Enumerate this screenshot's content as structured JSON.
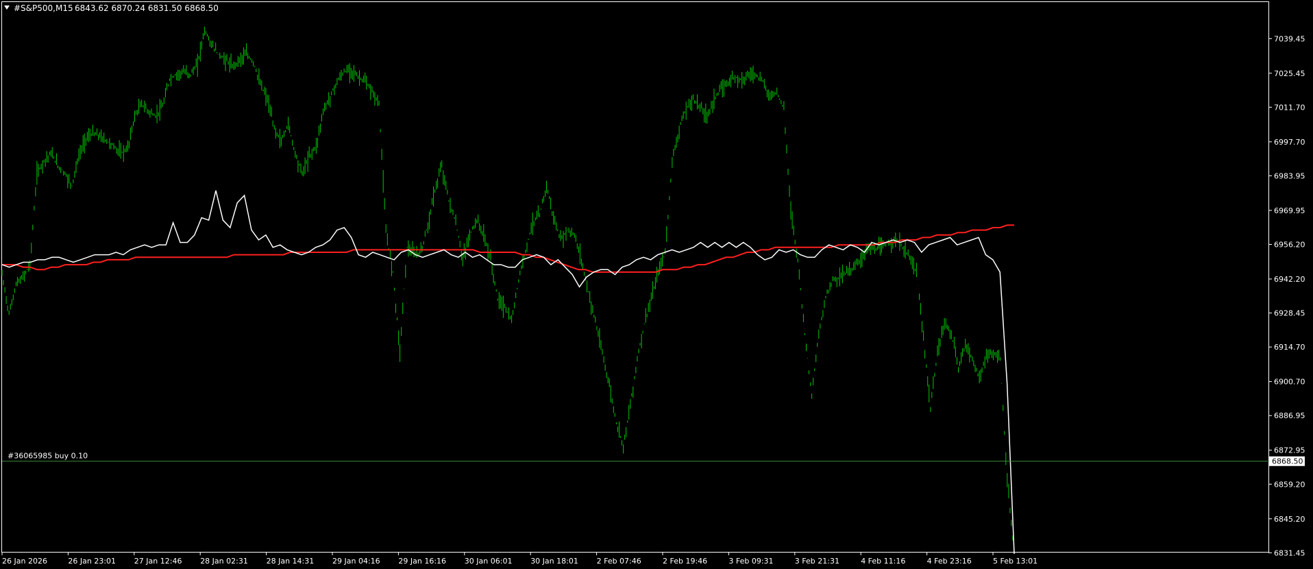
{
  "header": {
    "symbol": "#S&P500,M15",
    "ohlc": "6843.62 6870.24 6831.50 6868.50"
  },
  "order_label": "#36065985 buy 0.10",
  "current_price_label": "6868.50",
  "colors": {
    "background": "#000000",
    "axis": "#ffffff",
    "candles": "#00c800",
    "moving_average": "#ff1f1f",
    "indicator": "#ffffff",
    "order_line": "#3f8f3f",
    "price_box_bg": "#ffffff",
    "price_box_text": "#000000"
  },
  "icons": {
    "menu": "triangle-down-icon"
  },
  "chart_data": {
    "type": "line",
    "y_ticks": [
      "7039.45",
      "7025.45",
      "7011.70",
      "6997.70",
      "6983.95",
      "6969.95",
      "6956.20",
      "6942.20",
      "6928.45",
      "6914.70",
      "6900.70",
      "6886.95",
      "6872.95",
      "6859.20",
      "6845.20",
      "6831.45"
    ],
    "x_ticks": [
      "26 Jan 2026",
      "26 Jan 23:01",
      "27 Jan 12:46",
      "28 Jan 02:31",
      "28 Jan 14:31",
      "29 Jan 04:16",
      "29 Jan 16:16",
      "30 Jan 06:01",
      "30 Jan 18:01",
      "2 Feb 07:46",
      "2 Feb 19:46",
      "3 Feb 09:31",
      "3 Feb 21:31",
      "4 Feb 11:16",
      "4 Feb 23:16",
      "5 Feb 13:01"
    ],
    "ylim": [
      6826.0,
      7053.4
    ],
    "series": [
      {
        "values": [
          6944,
          6928,
          6940,
          6943,
          6948,
          6985,
          6990,
          6993,
          6988,
          6985,
          6980,
          6992,
          6999,
          7001,
          7000,
          6998,
          6996,
          6993,
          6995,
          7008,
          7013,
          7010,
          7008,
          7012,
          7023,
          7025,
          7026,
          7025,
          7029,
          7043,
          7037,
          7033,
          7031,
          7028,
          7031,
          7033,
          7030,
          7021,
          7015,
          7003,
          6998,
          7005,
          6993,
          6985,
          6992,
          6996,
          7010,
          7016,
          7022,
          7026,
          7027,
          7024,
          7022,
          7018,
          7013,
          6961,
          6945,
          6913,
          6955,
          6952,
          6953,
          6964,
          6978,
          6988,
          6974,
          6965,
          6950,
          6960,
          6966,
          6960,
          6950,
          6934,
          6931,
          6925,
          6942,
          6954,
          6965,
          6968,
          6980,
          6967,
          6958,
          6962,
          6960,
          6950,
          6937,
          6925,
          6912,
          6899,
          6884,
          6875,
          6891,
          6910,
          6924,
          6934,
          6945,
          6953,
          6990,
          7003,
          7011,
          7015,
          7012,
          7008,
          7015,
          7019,
          7022,
          7024,
          7023,
          7025,
          7025,
          7022,
          7016,
          7018,
          7011,
          6970,
          6950,
          6920,
          6895,
          6920,
          6935,
          6942,
          6943,
          6945,
          6947,
          6950,
          6955,
          6954,
          6955,
          6957,
          6958,
          6955,
          6951,
          6945,
          6918,
          6890,
          6912,
          6925,
          6920,
          6906,
          6916,
          6910,
          6902,
          6911,
          6912,
          6910,
          6860,
          6831
        ]
      },
      {
        "values": [
          6948,
          6947,
          6948,
          6949,
          6949,
          6950,
          6950,
          6951,
          6951,
          6950,
          6949,
          6950,
          6951,
          6952,
          6952,
          6952,
          6953,
          6952,
          6954,
          6955,
          6956,
          6955,
          6956,
          6956,
          6965,
          6957,
          6957,
          6960,
          6967,
          6966,
          6978,
          6966,
          6963,
          6973,
          6976,
          6962,
          6958,
          6960,
          6955,
          6956,
          6954,
          6953,
          6952,
          6953,
          6955,
          6956,
          6958,
          6962,
          6963,
          6959,
          6952,
          6951,
          6953,
          6952,
          6951,
          6950,
          6953,
          6954,
          6952,
          6951,
          6952,
          6953,
          6954,
          6952,
          6951,
          6953,
          6951,
          6952,
          6950,
          6948,
          6948,
          6947,
          6947,
          6950,
          6951,
          6952,
          6951,
          6948,
          6950,
          6947,
          6944,
          6939,
          6943,
          6945,
          6946,
          6946,
          6944,
          6947,
          6948,
          6950,
          6951,
          6950,
          6952,
          6953,
          6954,
          6953,
          6954,
          6955,
          6957,
          6955,
          6957,
          6955,
          6957,
          6955,
          6957,
          6955,
          6952,
          6950,
          6951,
          6954,
          6953,
          6954,
          6952,
          6951,
          6951,
          6954,
          6956,
          6955,
          6954,
          6956,
          6955,
          6953,
          6957,
          6956,
          6957,
          6958,
          6957,
          6958,
          6957,
          6953,
          6956,
          6957,
          6958,
          6959,
          6956,
          6957,
          6958,
          6959,
          6952,
          6950,
          6945,
          6900,
          6831
        ]
      },
      {
        "values": [
          6948,
          6948,
          6948,
          6947,
          6947,
          6946,
          6946,
          6947,
          6947,
          6948,
          6948,
          6948,
          6948,
          6949,
          6949,
          6950,
          6950,
          6950,
          6950,
          6951,
          6951,
          6951,
          6951,
          6951,
          6951,
          6951,
          6951,
          6951,
          6951,
          6951,
          6951,
          6951,
          6951,
          6952,
          6952,
          6952,
          6952,
          6952,
          6952,
          6952,
          6952,
          6953,
          6953,
          6953,
          6953,
          6953,
          6953,
          6953,
          6953,
          6953,
          6954,
          6954,
          6954,
          6954,
          6954,
          6954,
          6954,
          6954,
          6954,
          6954,
          6954,
          6954,
          6954,
          6954,
          6954,
          6954,
          6954,
          6954,
          6953,
          6953,
          6953,
          6953,
          6953,
          6953,
          6952,
          6952,
          6951,
          6951,
          6950,
          6949,
          6948,
          6947,
          6946,
          6946,
          6945,
          6945,
          6945,
          6945,
          6945,
          6945,
          6945,
          6945,
          6945,
          6945,
          6946,
          6946,
          6946,
          6947,
          6947,
          6948,
          6948,
          6949,
          6950,
          6951,
          6951,
          6952,
          6953,
          6953,
          6954,
          6954,
          6955,
          6955,
          6955,
          6955,
          6955,
          6955,
          6955,
          6955,
          6955,
          6956,
          6956,
          6956,
          6956,
          6956,
          6956,
          6957,
          6957,
          6957,
          6958,
          6958,
          6958,
          6959,
          6959,
          6960,
          6960,
          6960,
          6961,
          6961,
          6962,
          6962,
          6962,
          6963,
          6963,
          6964,
          6964
        ]
      }
    ]
  }
}
